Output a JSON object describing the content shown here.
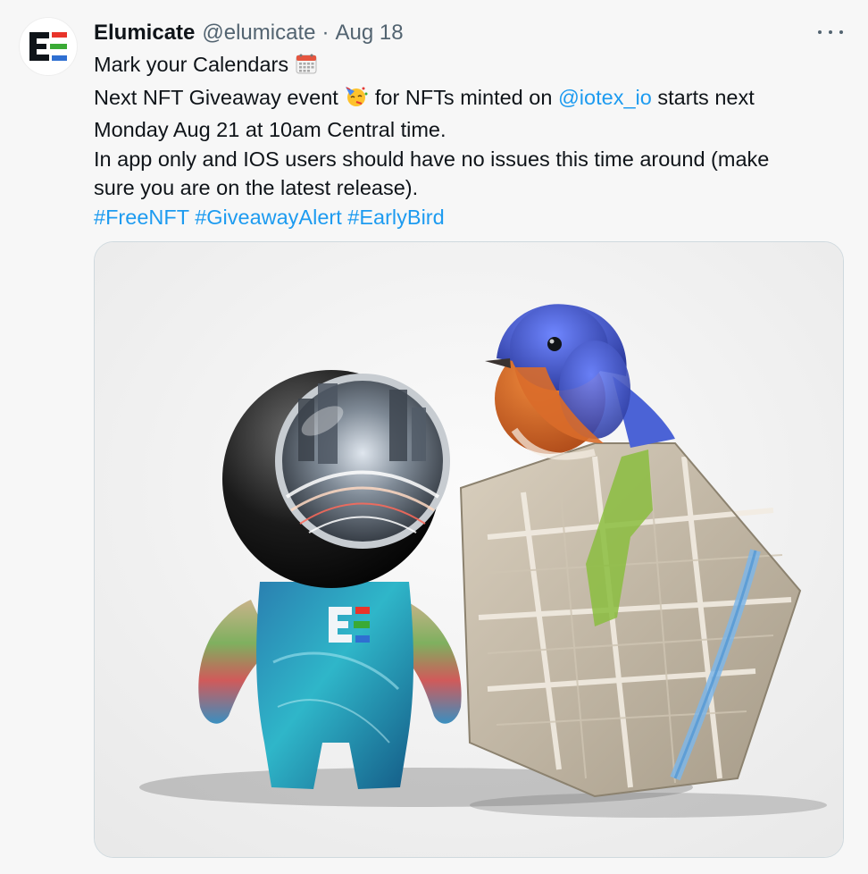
{
  "tweet": {
    "author_name": "Elumicate",
    "author_handle": "@elumicate",
    "separator": "·",
    "date": "Aug 18",
    "line1": "Mark your Calendars",
    "line2_a": "Next NFT Giveaway event",
    "line2_b": "for NFTs minted on",
    "mention": "@iotex_io",
    "line2_c": "starts next",
    "line3": "Monday Aug 21 at 10am Central time.",
    "line4": "In app only and IOS users should have no issues this time around (make",
    "line5": "sure you are on the latest release).",
    "hashtags": [
      "#FreeNFT",
      "#GiveawayAlert",
      "#EarlyBird"
    ]
  },
  "icons": {
    "avatar": "elumicate-logo",
    "more": "more-horizontal-icon",
    "calendar_emoji": "calendar-emoji",
    "party_emoji": "party-face-emoji"
  },
  "colors": {
    "text": "#0f1419",
    "muted": "#536471",
    "link": "#1d9bf0",
    "border": "#cfd9de",
    "logo_red": "#e8342a",
    "logo_green": "#3aaa35",
    "logo_blue": "#2f6fd1"
  }
}
